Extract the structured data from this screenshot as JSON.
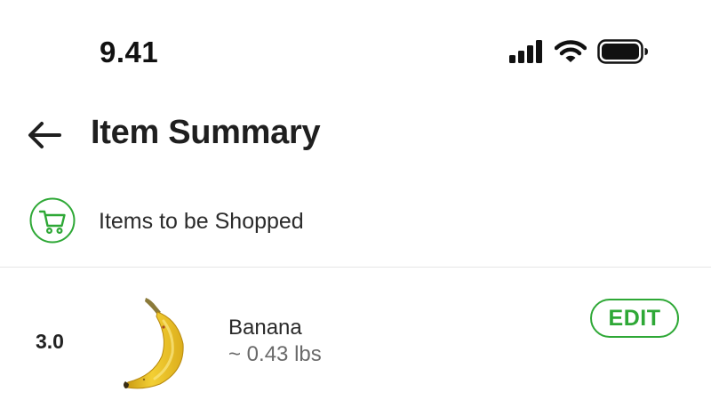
{
  "status_bar": {
    "time": "9.41",
    "icons": [
      "cellular-signal-icon",
      "wifi-icon",
      "battery-icon"
    ]
  },
  "header": {
    "back_icon": "back-arrow-icon",
    "title": "Item Summary"
  },
  "section": {
    "icon": "shopping-cart-icon",
    "label": "Items to be Shopped",
    "accent_color": "#2ea836"
  },
  "items": [
    {
      "quantity": "3.0",
      "image": "banana-image",
      "name": "Banana",
      "weight": "~ 0.43 lbs",
      "edit_label": "EDIT"
    }
  ]
}
